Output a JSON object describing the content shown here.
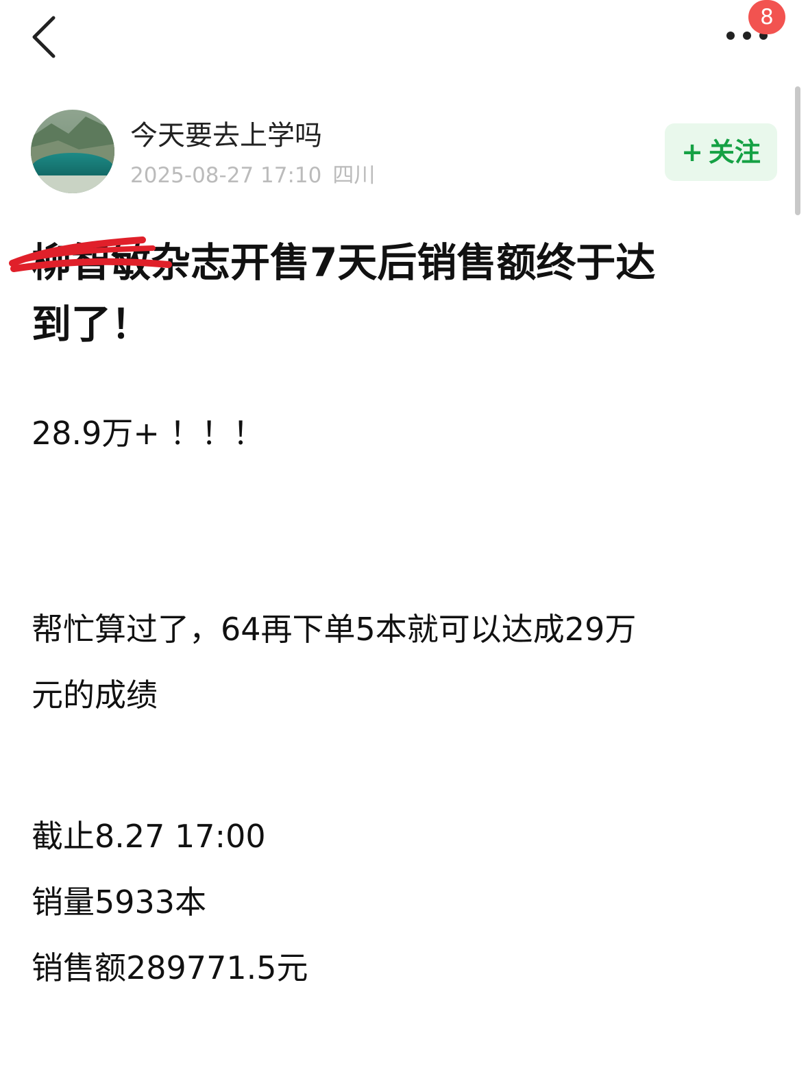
{
  "nav": {
    "back_icon": "chevron-left-icon",
    "more_icon": "ellipsis-icon",
    "badge_count": "8"
  },
  "author": {
    "name": "今天要去上学吗",
    "date": "2025-08-27 17:10",
    "location": "四川",
    "avatar": "lake-landscape-avatar"
  },
  "follow": {
    "plus": "+",
    "label": "关注",
    "color": "#15a144",
    "background": "#e9f8ec"
  },
  "post": {
    "title_hidden": "柳智敏",
    "title_rest_line1": "杂志开售7天后销售额终于达",
    "title_line2": "到了！",
    "scribble_color": "#e0202a",
    "p1": "28.9万+ ！！！",
    "p2_line1": "帮忙算过了，64再下单5本就可以达成29万",
    "p2_line2": "元的成绩",
    "p3_line1": "截止8.27  17:00",
    "p3_line2": "销量5933本",
    "p3_line3": "销售额289771.5元"
  }
}
